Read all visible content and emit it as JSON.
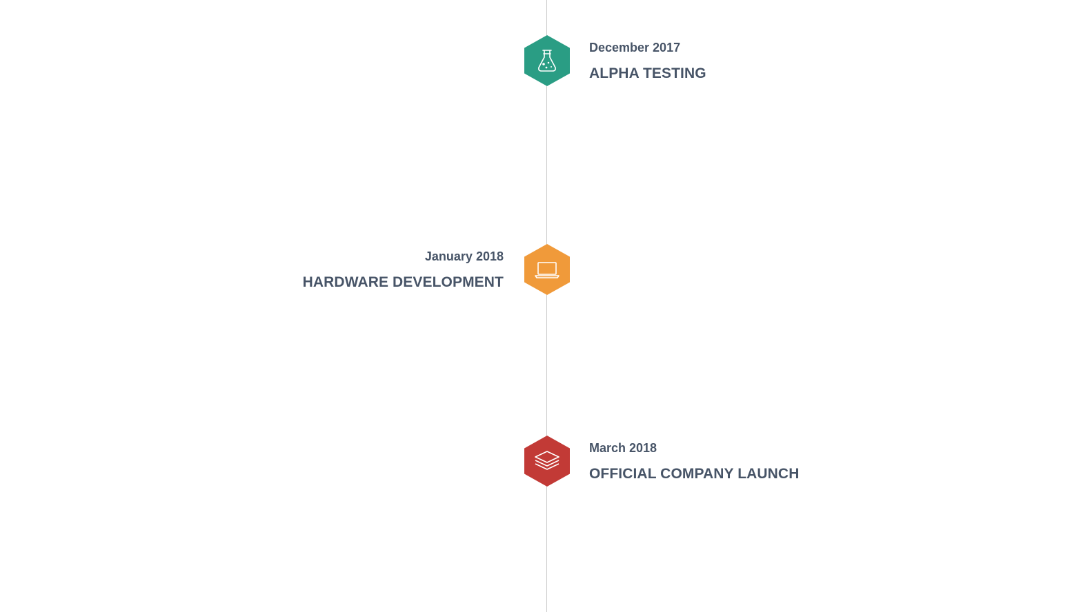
{
  "timeline": {
    "events": [
      {
        "date": "December 2017",
        "title": "ALPHA TESTING",
        "side": "right",
        "color": "#2a9d84",
        "icon": "flask-icon"
      },
      {
        "date": "January 2018",
        "title": "HARDWARE DEVELOPMENT",
        "side": "left",
        "color": "#f09a3a",
        "icon": "laptop-icon"
      },
      {
        "date": "March 2018",
        "title": "OFFICIAL COMPANY LAUNCH",
        "side": "right",
        "color": "#c23a36",
        "icon": "layers-icon"
      }
    ],
    "line_color": "#c9c9c9",
    "text_color": "#475467"
  }
}
